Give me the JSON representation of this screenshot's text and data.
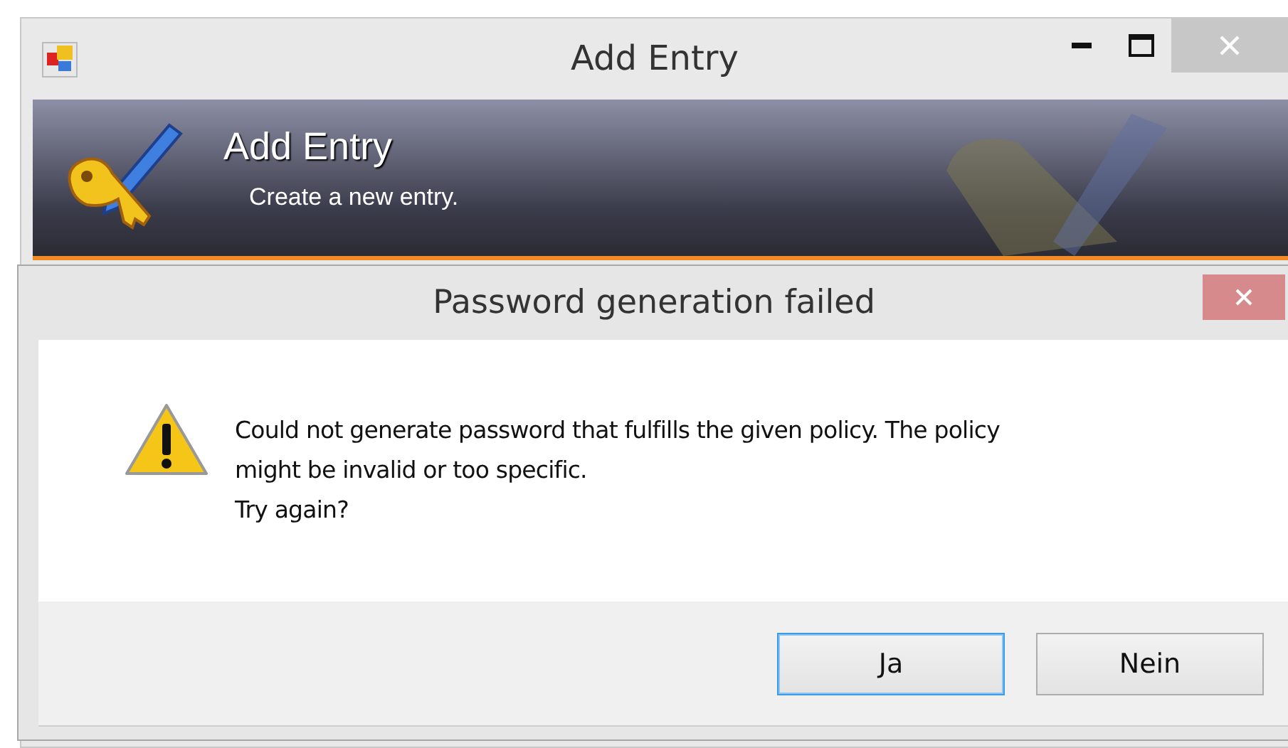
{
  "window": {
    "title": "Add Entry"
  },
  "banner": {
    "title": "Add Entry",
    "subtitle": "Create a new entry."
  },
  "dialog": {
    "title": "Password generation failed",
    "kind": "warning",
    "message_lines": [
      "Could not generate password that fulfills the given policy. The policy",
      "might be invalid or too specific.",
      "Try again?"
    ],
    "buttons": [
      {
        "label": "Ja",
        "default": true
      },
      {
        "label": "Nein",
        "default": false
      }
    ]
  }
}
